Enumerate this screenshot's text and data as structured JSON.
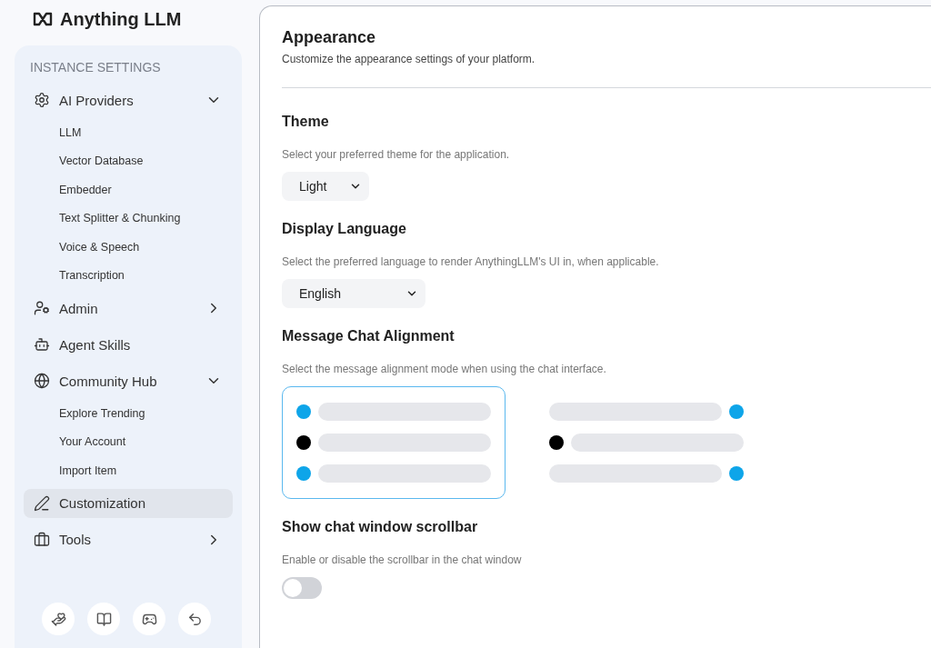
{
  "brand": {
    "name": "Anything LLM"
  },
  "sidebar": {
    "heading": "INSTANCE SETTINGS",
    "items": [
      {
        "label": "AI Providers",
        "kind": "group",
        "expanded": true,
        "selected": false,
        "children": [
          {
            "label": "LLM",
            "selected": false
          },
          {
            "label": "Vector Database",
            "selected": false
          },
          {
            "label": "Embedder",
            "selected": false
          },
          {
            "label": "Text Splitter & Chunking",
            "selected": false
          },
          {
            "label": "Voice & Speech",
            "selected": false
          },
          {
            "label": "Transcription",
            "selected": false
          }
        ]
      },
      {
        "label": "Admin",
        "kind": "group",
        "expanded": false,
        "selected": false
      },
      {
        "label": "Agent Skills",
        "kind": "link",
        "selected": false
      },
      {
        "label": "Community Hub",
        "kind": "group",
        "expanded": true,
        "selected": false,
        "children": [
          {
            "label": "Explore Trending",
            "selected": false
          },
          {
            "label": "Your Account",
            "selected": false
          },
          {
            "label": "Import Item",
            "selected": false
          }
        ]
      },
      {
        "label": "Customization",
        "kind": "link",
        "selected": true
      },
      {
        "label": "Tools",
        "kind": "group",
        "expanded": false,
        "selected": false
      }
    ]
  },
  "page": {
    "title": "Appearance",
    "subtitle": "Customize the appearance settings of your platform.",
    "sections": [
      {
        "kind": "select",
        "title": "Theme",
        "description": "Select your preferred theme for the application.",
        "value": "Light"
      },
      {
        "kind": "select",
        "title": "Display Language",
        "description": "Select the preferred language to render AnythingLLM's UI in, when applicable.",
        "value": "English"
      },
      {
        "kind": "alignment",
        "title": "Message Chat Alignment",
        "description": "Select the message alignment mode when using the chat interface.",
        "options": [
          {
            "kind": "left",
            "selected": true
          },
          {
            "kind": "split",
            "selected": false
          }
        ]
      },
      {
        "kind": "toggle",
        "title": "Show chat window scrollbar",
        "description": "Enable or disable the scrollbar in the chat window",
        "on": false
      }
    ]
  }
}
